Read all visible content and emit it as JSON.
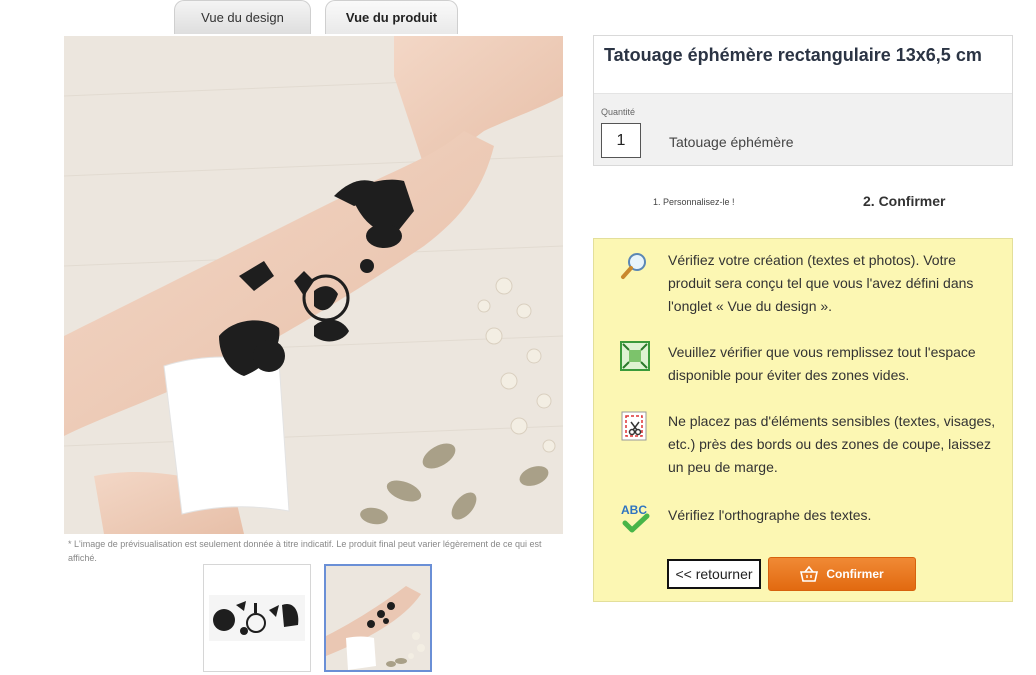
{
  "tabs": [
    {
      "label": "Vue du design",
      "active": false
    },
    {
      "label": "Vue du produit",
      "active": true
    }
  ],
  "preview": {
    "disclaimer": "* L'image de prévisualisation est seulement donnée à titre indicatif. Le produit final peut varier légèrement de ce qui est affiché."
  },
  "product": {
    "title": "Tatouage éphémère rectangulaire 13x6,5 cm",
    "quantity_label": "Quantité",
    "quantity_value": "1",
    "product_type": "Tatouage éphémère"
  },
  "steps": {
    "step1": "1. Personnalisez-le !",
    "step2": "2. Confirmer"
  },
  "checks": [
    {
      "icon": "magnifier-icon",
      "text": "Vérifiez votre création (textes et photos). Votre produit sera conçu tel que vous l'avez défini dans l'onglet « Vue du design »."
    },
    {
      "icon": "fill-area-icon",
      "text": "Veuillez vérifier que vous remplissez tout l'espace disponible pour éviter des zones vides."
    },
    {
      "icon": "scissors-margin-icon",
      "text": "Ne placez pas d'éléments sensibles (textes, visages, etc.) près des bords ou des zones de coupe, laissez un peu de marge."
    },
    {
      "icon": "abc-spellcheck-icon",
      "text": "Vérifiez l'orthographe des textes."
    }
  ],
  "buttons": {
    "back": "<< retourner",
    "confirm": "Confirmer"
  },
  "colors": {
    "info_bg": "#fcf7b3",
    "confirm_orange": "#e8781f",
    "thumb_selected": "#6a8fd6"
  }
}
